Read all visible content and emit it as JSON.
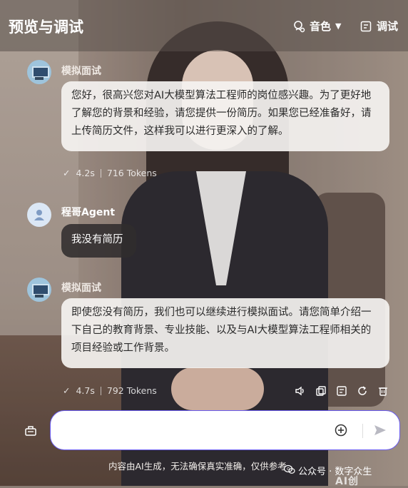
{
  "header": {
    "title": "预览与调试",
    "voice_label": "音色",
    "debug_label": "调试"
  },
  "messages": [
    {
      "sender": "模拟面试",
      "text": "您好，很高兴您对AI大模型算法工程师的岗位感兴趣。为了更好地了解您的背景和经验，请您提供一份简历。如果您已经准备好，请上传简历文件，这样我可以进行更深入的了解。",
      "time": "4.2s",
      "tokens": "716 Tokens"
    },
    {
      "sender": "程哥Agent",
      "text": "我没有简历"
    },
    {
      "sender": "模拟面试",
      "text": "即使您没有简历，我们也可以继续进行模拟面试。请您简单介绍一下自己的教育背景、专业技能、以及与AI大模型算法工程师相关的项目经验或工作背景。",
      "time": "4.7s",
      "tokens": "792 Tokens"
    }
  ],
  "input": {
    "value": "",
    "placeholder": ""
  },
  "footer": {
    "disclaimer": "内容由AI生成，无法确保真实准确，仅供参考。",
    "watermark": "公众号 · 数字众生",
    "corner": "AI创"
  },
  "colors": {
    "accent": "#6a5cf0",
    "bubble": "#f5f3f1",
    "user_bubble": "#302c2e"
  },
  "icons": [
    "voice-settings-icon",
    "caret-down-icon",
    "debug-icon",
    "check-icon",
    "speaker-icon",
    "copy-icon",
    "note-icon",
    "refresh-icon",
    "trash-icon",
    "plus-circle-icon",
    "send-icon",
    "toolbox-icon",
    "wechat-icon"
  ]
}
